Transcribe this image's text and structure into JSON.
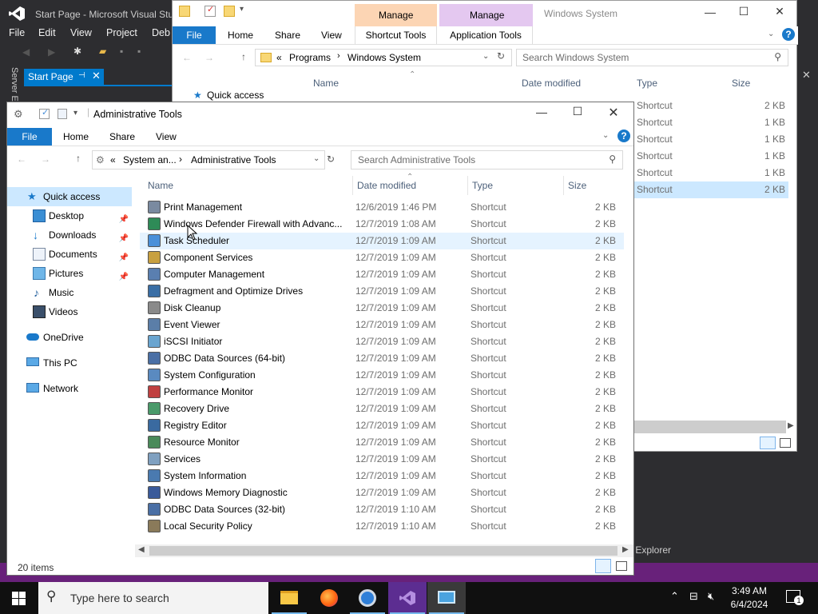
{
  "vs": {
    "title": "Start Page - Microsoft Visual Stu",
    "menu": [
      "File",
      "Edit",
      "View",
      "Project",
      "Deb"
    ],
    "start_page_tab": "Start Page",
    "server_explorer_vertical": "Server E",
    "server_explorer_bottom": "m Explorer"
  },
  "windows_system": {
    "title": "Windows System",
    "context_tab_1": "Manage",
    "context_tab_2": "Manage",
    "ribbon_tabs": [
      "File",
      "Home",
      "Share",
      "View",
      "Shortcut Tools",
      "Application Tools"
    ],
    "breadcrumb": [
      "«",
      "Programs",
      "Windows System"
    ],
    "search_placeholder": "Search Windows System",
    "quick_access": "Quick access",
    "columns": [
      "Name",
      "Date modified",
      "Type",
      "Size"
    ],
    "rows": [
      {
        "type": "Shortcut",
        "size": "2 KB"
      },
      {
        "type": "Shortcut",
        "size": "1 KB"
      },
      {
        "type": "Shortcut",
        "size": "1 KB"
      },
      {
        "type": "Shortcut",
        "size": "1 KB"
      },
      {
        "type": "Shortcut",
        "size": "1 KB"
      },
      {
        "type": "Shortcut",
        "size": "2 KB"
      }
    ]
  },
  "admin_tools": {
    "title": "Administrative Tools",
    "ribbon_tabs": [
      "File",
      "Home",
      "Share",
      "View"
    ],
    "breadcrumb": [
      "«",
      "System an...",
      "Administrative Tools"
    ],
    "search_placeholder": "Search Administrative Tools",
    "columns": [
      "Name",
      "Date modified",
      "Type",
      "Size"
    ],
    "nav": [
      {
        "label": "Quick access",
        "icon": "star-icon"
      },
      {
        "label": "Desktop",
        "icon": "desktop-icon"
      },
      {
        "label": "Downloads",
        "icon": "download-icon"
      },
      {
        "label": "Documents",
        "icon": "documents-icon"
      },
      {
        "label": "Pictures",
        "icon": "pictures-icon"
      },
      {
        "label": "Music",
        "icon": "music-icon"
      },
      {
        "label": "Videos",
        "icon": "videos-icon"
      },
      {
        "label": "OneDrive",
        "icon": "cloud-icon"
      },
      {
        "label": "This PC",
        "icon": "computer-icon"
      },
      {
        "label": "Network",
        "icon": "network-icon"
      }
    ],
    "files": [
      {
        "name": "Print Management",
        "date": "12/6/2019 1:46 PM",
        "type": "Shortcut",
        "size": "2 KB"
      },
      {
        "name": "Windows Defender Firewall with Advanc...",
        "date": "12/7/2019 1:08 AM",
        "type": "Shortcut",
        "size": "2 KB"
      },
      {
        "name": "Task Scheduler",
        "date": "12/7/2019 1:09 AM",
        "type": "Shortcut",
        "size": "2 KB"
      },
      {
        "name": "Component Services",
        "date": "12/7/2019 1:09 AM",
        "type": "Shortcut",
        "size": "2 KB"
      },
      {
        "name": "Computer Management",
        "date": "12/7/2019 1:09 AM",
        "type": "Shortcut",
        "size": "2 KB"
      },
      {
        "name": "Defragment and Optimize Drives",
        "date": "12/7/2019 1:09 AM",
        "type": "Shortcut",
        "size": "2 KB"
      },
      {
        "name": "Disk Cleanup",
        "date": "12/7/2019 1:09 AM",
        "type": "Shortcut",
        "size": "2 KB"
      },
      {
        "name": "Event Viewer",
        "date": "12/7/2019 1:09 AM",
        "type": "Shortcut",
        "size": "2 KB"
      },
      {
        "name": "iSCSI Initiator",
        "date": "12/7/2019 1:09 AM",
        "type": "Shortcut",
        "size": "2 KB"
      },
      {
        "name": "ODBC Data Sources (64-bit)",
        "date": "12/7/2019 1:09 AM",
        "type": "Shortcut",
        "size": "2 KB"
      },
      {
        "name": "System Configuration",
        "date": "12/7/2019 1:09 AM",
        "type": "Shortcut",
        "size": "2 KB"
      },
      {
        "name": "Performance Monitor",
        "date": "12/7/2019 1:09 AM",
        "type": "Shortcut",
        "size": "2 KB"
      },
      {
        "name": "Recovery Drive",
        "date": "12/7/2019 1:09 AM",
        "type": "Shortcut",
        "size": "2 KB"
      },
      {
        "name": "Registry Editor",
        "date": "12/7/2019 1:09 AM",
        "type": "Shortcut",
        "size": "2 KB"
      },
      {
        "name": "Resource Monitor",
        "date": "12/7/2019 1:09 AM",
        "type": "Shortcut",
        "size": "2 KB"
      },
      {
        "name": "Services",
        "date": "12/7/2019 1:09 AM",
        "type": "Shortcut",
        "size": "2 KB"
      },
      {
        "name": "System Information",
        "date": "12/7/2019 1:09 AM",
        "type": "Shortcut",
        "size": "2 KB"
      },
      {
        "name": "Windows Memory Diagnostic",
        "date": "12/7/2019 1:09 AM",
        "type": "Shortcut",
        "size": "2 KB"
      },
      {
        "name": "ODBC Data Sources (32-bit)",
        "date": "12/7/2019 1:10 AM",
        "type": "Shortcut",
        "size": "2 KB"
      },
      {
        "name": "Local Security Policy",
        "date": "12/7/2019 1:10 AM",
        "type": "Shortcut",
        "size": "2 KB"
      }
    ],
    "selected_index": 2,
    "status": "20 items"
  },
  "taskbar": {
    "search_placeholder": "Type here to search",
    "time": "3:49 AM",
    "date": "6/4/2024",
    "notification_count": "1",
    "apps": [
      "file-explorer-icon",
      "firefox-icon",
      "chrome-icon",
      "visual-studio-icon",
      "remote-desktop-icon"
    ]
  },
  "colors": {
    "accent": "#1979ca",
    "manage_tab_1": "#fcd5b4",
    "manage_tab_2": "#e4c8f0",
    "selection": "#e5f3ff",
    "vs_purple": "#68217a"
  }
}
